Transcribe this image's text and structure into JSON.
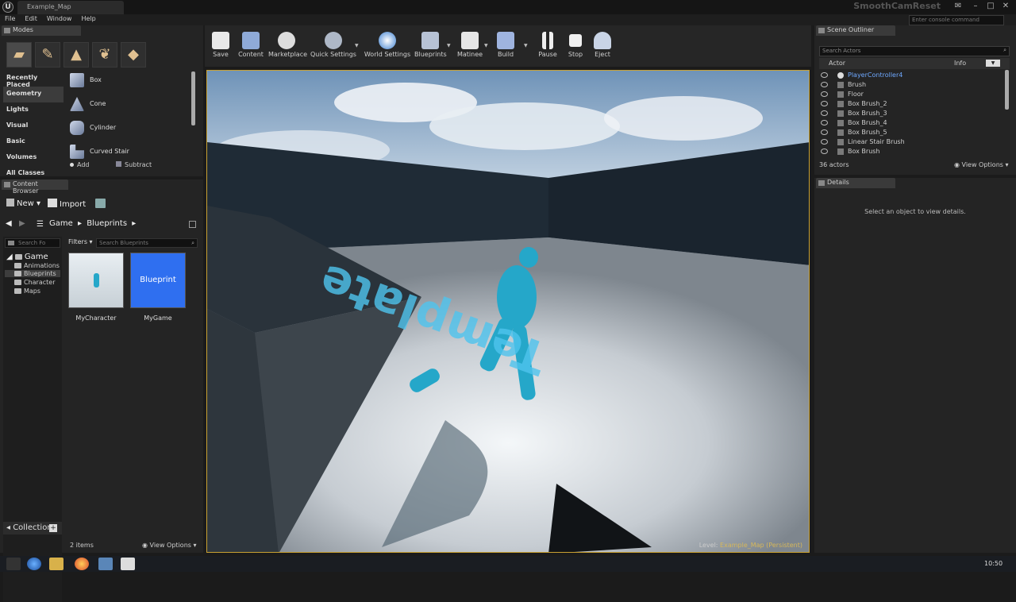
{
  "window": {
    "tab_title": "Example_Map",
    "project_name": "SmoothCamReset",
    "console_placeholder": "Enter console command"
  },
  "menu": [
    "File",
    "Edit",
    "Window",
    "Help"
  ],
  "modes": {
    "tab": "Modes",
    "categories": [
      "Recently Placed",
      "Geometry",
      "Lights",
      "Visual",
      "Basic",
      "Volumes",
      "All Classes"
    ],
    "active_category": "Geometry",
    "items": [
      "Box",
      "Cone",
      "Cylinder",
      "Curved Stair"
    ],
    "add_label": "Add",
    "subtract_label": "Subtract"
  },
  "content_browser": {
    "tab": "Content Browser",
    "new_label": "New",
    "import_label": "Import",
    "breadcrumb": [
      "Game",
      "Blueprints"
    ],
    "search_folders_placeholder": "Search Fo",
    "filters_label": "Filters",
    "search_blueprints_placeholder": "Search Blueprints",
    "tree": {
      "root": "Game",
      "children": [
        "Animations",
        "Blueprints",
        "Character",
        "Maps"
      ]
    },
    "assets": [
      {
        "name": "MyCharacter",
        "thumb_label": ""
      },
      {
        "name": "MyGame",
        "thumb_label": "Blueprint"
      }
    ],
    "collections_label": "Collection",
    "item_count": "2 items",
    "view_options": "View Options"
  },
  "toolbar": {
    "buttons": [
      "Save",
      "Content",
      "Marketplace",
      "Quick Settings",
      "World Settings",
      "Blueprints",
      "Matinee",
      "Build",
      "Pause",
      "Stop",
      "Eject"
    ]
  },
  "viewport": {
    "level_label": "Level:",
    "level_name": "Example_Map (Persistent)",
    "floor_text": "Template"
  },
  "outliner": {
    "tab": "Scene Outliner",
    "search_placeholder": "Search Actors",
    "col_actor": "Actor",
    "col_info": "Info",
    "actors": [
      "PlayerController4",
      "Brush",
      "Floor",
      "Box Brush_2",
      "Box Brush_3",
      "Box Brush_4",
      "Box Brush_5",
      "Linear Stair Brush",
      "Box Brush"
    ],
    "count": "36 actors",
    "view_options": "View Options"
  },
  "details": {
    "tab": "Details",
    "empty_message": "Select an object to view details."
  },
  "taskbar": {
    "clock": "10:50"
  },
  "colors": {
    "highlight": "#c9a132",
    "blueprint_blue": "#2f6ff0",
    "character": "#25a7c9",
    "link_blue": "#6fa9ff"
  }
}
